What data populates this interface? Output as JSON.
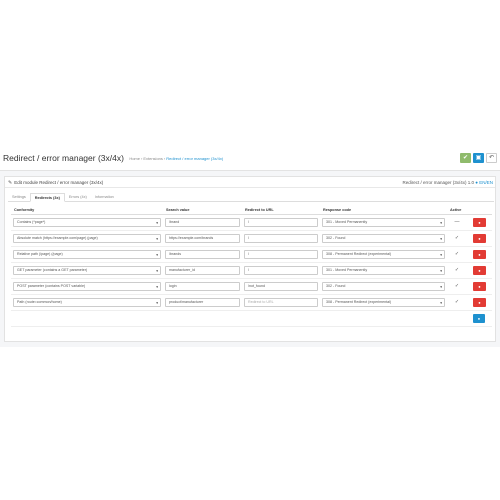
{
  "header": {
    "title": "Redirect / error manager (3x/4x)",
    "breadcrumb": [
      "Home",
      "Extensions",
      "Redirect / error manager (3x/4x)"
    ],
    "save_icon": "check-icon",
    "save_stay_icon": "save-icon",
    "back_icon": "reply-icon"
  },
  "panel": {
    "title": "Edit module Redirect / error manager (3x/4x)",
    "right_label": "Redirect / error manager (3x/4x) 1.0",
    "right_link": "EN/EN"
  },
  "tabs": [
    {
      "label": "Settings"
    },
    {
      "label": "Redirects (3x)"
    },
    {
      "label": "Errors (4x)"
    },
    {
      "label": "Information"
    }
  ],
  "table": {
    "headers": [
      "Conformity",
      "Search value",
      "Redirect to URL",
      "Response code",
      "Active"
    ],
    "rows": [
      {
        "conformity": "Contains (*page*)",
        "search": "/brand",
        "redirect": "/",
        "response": "301 - Moved Permanently",
        "active": "—"
      },
      {
        "conformity": "Absolute match (https://example.com/page) (page)",
        "search": "https://example.com/brands",
        "redirect": "/",
        "response": "302 - Found",
        "active": "✓"
      },
      {
        "conformity": "Relative path (/page) (/page)",
        "search": "/brands",
        "redirect": "/",
        "response": "308 - Permanent Redirect (experimental)",
        "active": "✓"
      },
      {
        "conformity": "GET parameter (contains a GET parameter)",
        "search": "manufacturer_id",
        "redirect": "/",
        "response": "301 - Moved Permanently",
        "active": "✓"
      },
      {
        "conformity": "POST parameter (contains POST variable)",
        "search": "login",
        "redirect": "/not_found",
        "response": "302 - Found",
        "active": "✓"
      },
      {
        "conformity": "Path (route=common/home)",
        "search": "product/manufacturer",
        "redirect": "",
        "redirect_placeholder": "Redirect to URL",
        "response": "308 - Permanent Redirect (experimental)",
        "active": "✓"
      }
    ]
  },
  "icons": {
    "delete": "minus-circle-icon",
    "add": "plus-circle-icon",
    "caret": "chevron-down-icon"
  },
  "colors": {
    "primary": "#1e91cf",
    "success": "#8fbb6c",
    "danger": "#e23b34"
  }
}
